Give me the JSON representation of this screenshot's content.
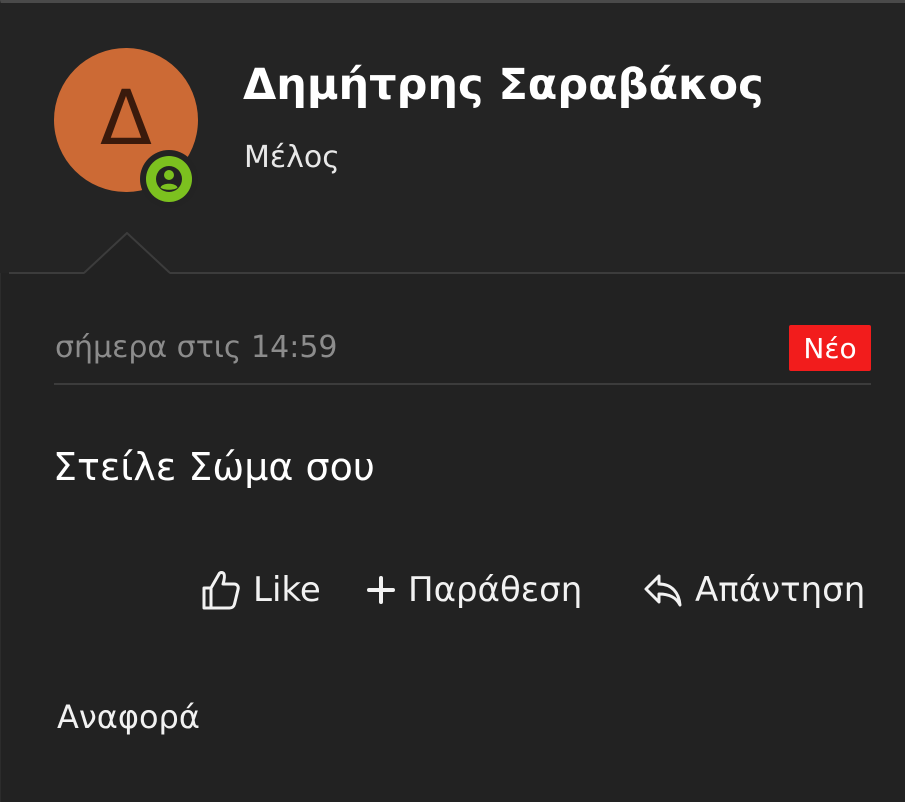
{
  "author": {
    "avatar_letter": "Δ",
    "avatar_color": "#cc6a35",
    "status_icon": "user-online-icon",
    "status_color": "#7cc11f",
    "name": "Δημήτρης Σαραβάκος",
    "role": "Μέλος"
  },
  "post": {
    "timestamp": "σήμερα στις 14:59",
    "new_badge": "Νέο",
    "new_badge_color": "#f21c1c",
    "message": "Στείλε Σώμα σου"
  },
  "actions": {
    "like_label": "Like",
    "like_icon": "thumbs-up-icon",
    "quote_label": "Παράθεση",
    "quote_icon": "plus-icon",
    "reply_label": "Απάντηση",
    "reply_icon": "reply-icon",
    "report_label": "Αναφορά"
  }
}
